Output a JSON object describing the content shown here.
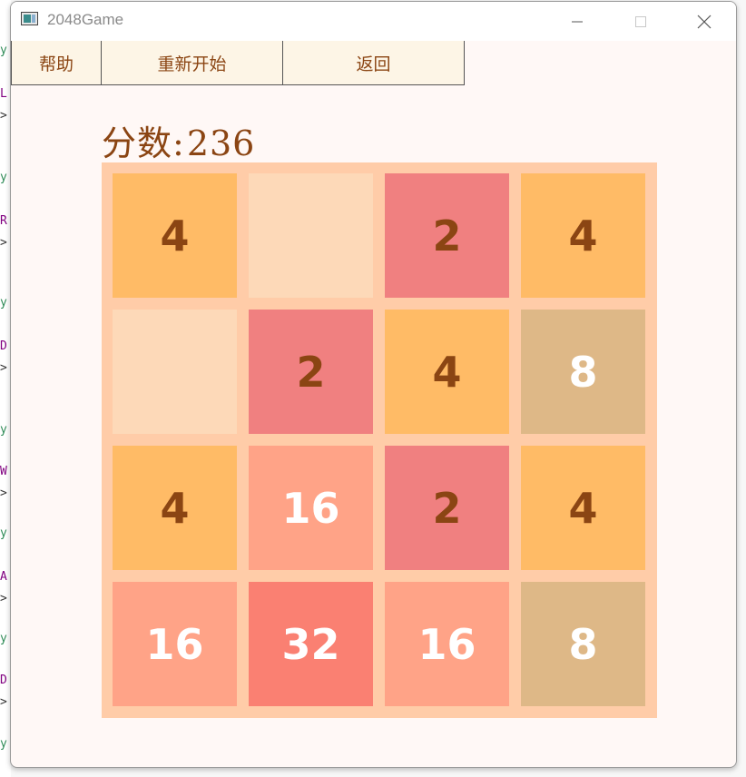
{
  "window": {
    "title": "2048Game",
    "icon": "app-window-icon",
    "controls": [
      "minimize-icon",
      "maximize-icon",
      "close-icon"
    ]
  },
  "menu": {
    "help": "帮助",
    "restart": "重新开始",
    "back": "返回"
  },
  "score": {
    "label": "分数:",
    "value": "236"
  },
  "colors": {
    "window_bg": "#fff8f6",
    "board_bg": "#ffcca8",
    "menu_bg": "#fdf5e6",
    "text_brown": "#8b4513"
  },
  "board": {
    "size": 4,
    "cells": [
      [
        "4",
        "",
        "2",
        "4"
      ],
      [
        "",
        "2",
        "4",
        "8"
      ],
      [
        "4",
        "16",
        "2",
        "4"
      ],
      [
        "16",
        "32",
        "16",
        "8"
      ]
    ]
  },
  "tile_styles": {
    "": {
      "bg": "#fdd9b8",
      "fg": "#8b4513"
    },
    "2": {
      "bg": "#f08080",
      "fg": "#8b4513"
    },
    "4": {
      "bg": "#ffbb66",
      "fg": "#8b4513"
    },
    "8": {
      "bg": "#deb887",
      "fg": "#ffffff"
    },
    "16": {
      "bg": "#ffa387",
      "fg": "#ffffff"
    },
    "32": {
      "bg": "#fa8072",
      "fg": "#ffffff"
    }
  }
}
